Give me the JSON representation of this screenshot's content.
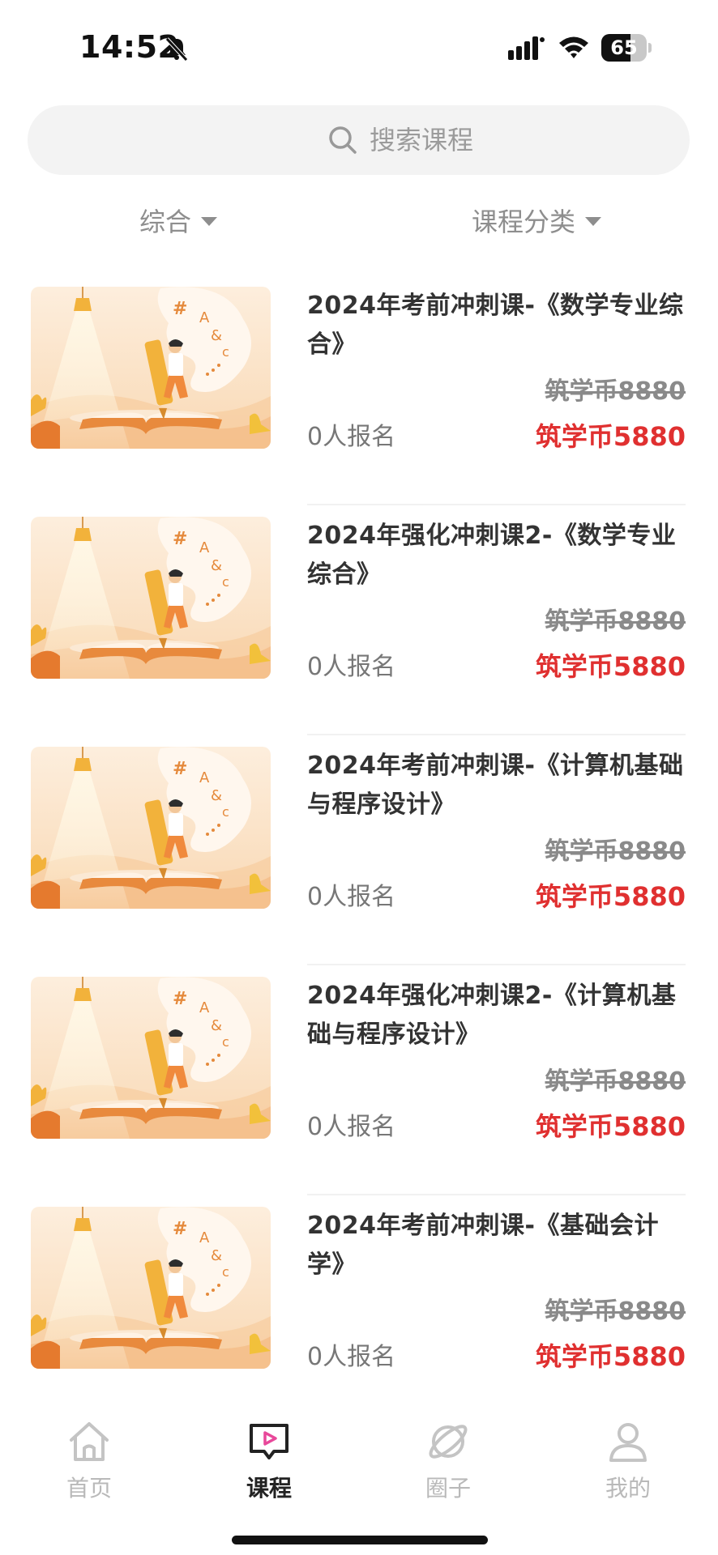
{
  "status_bar": {
    "time": "14:52",
    "battery": "65",
    "battery_level": 0.65
  },
  "search": {
    "placeholder": "搜索课程"
  },
  "filters": [
    {
      "label": "综合"
    },
    {
      "label": "课程分类"
    }
  ],
  "courses": [
    {
      "title": "2024年考前冲刺课-《数学专业综合》",
      "old_price": "筑学币8880",
      "enrolled": "0人报名",
      "price": "筑学币5880"
    },
    {
      "title": "2024年强化冲刺课2-《数学专业综合》",
      "old_price": "筑学币8880",
      "enrolled": "0人报名",
      "price": "筑学币5880"
    },
    {
      "title": "2024年考前冲刺课-《计算机基础与程序设计》",
      "old_price": "筑学币8880",
      "enrolled": "0人报名",
      "price": "筑学币5880"
    },
    {
      "title": "2024年强化冲刺课2-《计算机基础与程序设计》",
      "old_price": "筑学币8880",
      "enrolled": "0人报名",
      "price": "筑学币5880"
    },
    {
      "title": "2024年考前冲刺课-《基础会计学》",
      "old_price": "筑学币8880",
      "enrolled": "0人报名",
      "price": "筑学币5880"
    }
  ],
  "nav": [
    {
      "label": "首页",
      "icon": "home-icon",
      "active": false
    },
    {
      "label": "课程",
      "icon": "course-play-icon",
      "active": true
    },
    {
      "label": "圈子",
      "icon": "planet-icon",
      "active": false
    },
    {
      "label": "我的",
      "icon": "user-icon",
      "active": false
    }
  ],
  "colors": {
    "price": "#e03030",
    "accent": "#e8489a",
    "thumb_bg": "#fbe3c8"
  }
}
